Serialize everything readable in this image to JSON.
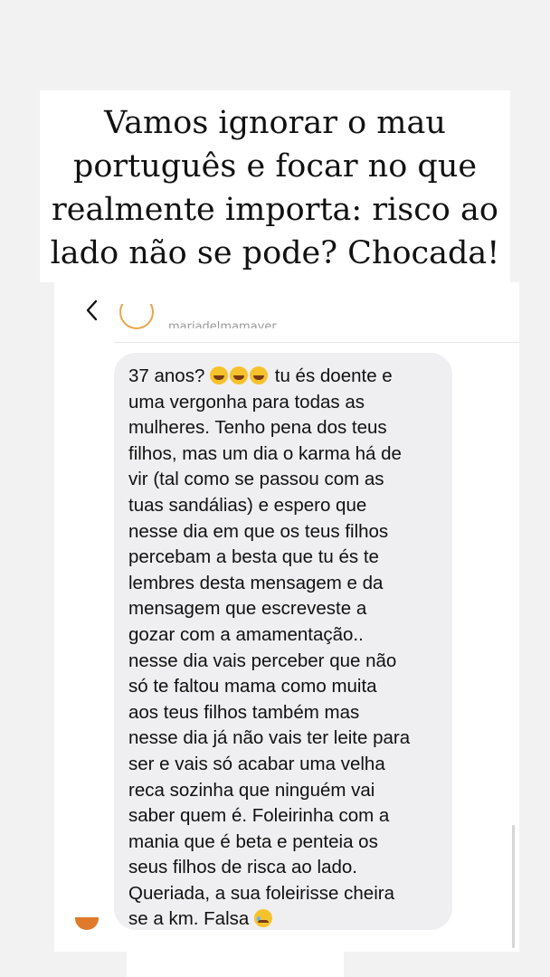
{
  "story": {
    "caption_lines": [
      "Vamos ignorar o mau",
      "português e focar no que",
      "realmente importa: risco ao",
      "lado não se pode? Chocada!"
    ]
  },
  "dm_header": {
    "username": "mariadelmamayer",
    "back_icon": "chevron-left-icon"
  },
  "message": {
    "lines": [
      {
        "pre": "37 anos? ",
        "emoji_count": 3,
        "post": " tu és doente e"
      },
      {
        "text": "uma vergonha para todas as"
      },
      {
        "text": "mulheres. Tenho pena dos teus"
      },
      {
        "text": "filhos, mas um dia o karma há de"
      },
      {
        "text": "vir (tal como se passou com as"
      },
      {
        "text": "tuas sandálias) e espero que"
      },
      {
        "text": "nesse dia em que os teus filhos"
      },
      {
        "text": "percebam a besta que tu és te"
      },
      {
        "text": "lembres desta mensagem e da"
      },
      {
        "text": "mensagem que escreveste a"
      },
      {
        "text": "gozar com a amamentação.."
      },
      {
        "text": "nesse dia vais perceber que não"
      },
      {
        "text": "só te faltou mama como muita"
      },
      {
        "text": "aos teus filhos também mas"
      },
      {
        "text": "nesse dia já não vais ter leite para"
      },
      {
        "text": "ser e vais só acabar uma velha"
      },
      {
        "text": "reca sozinha que ninguém vai"
      },
      {
        "text": "saber quem é. Foleirinha com a"
      },
      {
        "text": "mania que é beta e penteia os"
      },
      {
        "text": "seus filhos de risca ao lado."
      },
      {
        "text": "Queriada, a sua foleirisse cheira"
      },
      {
        "pre": "se a km. Falsa ",
        "emoji_count": 1,
        "post": ""
      }
    ],
    "emojis": {
      "laugh": "rolling-on-floor-laughing-emoji",
      "sad": "crying-face-emoji"
    }
  },
  "colors": {
    "bubble": "#efeff1",
    "avatar_ring": "#e8a54a",
    "avatar_bottom": "#e07a2b"
  }
}
